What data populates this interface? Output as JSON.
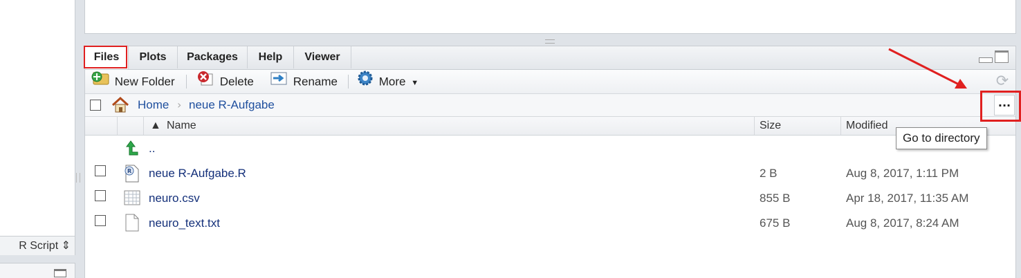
{
  "left_editor": {
    "filetype_label": "R Script ⇕"
  },
  "tabs": [
    {
      "label": "Files",
      "active": true
    },
    {
      "label": "Plots"
    },
    {
      "label": "Packages"
    },
    {
      "label": "Help"
    },
    {
      "label": "Viewer"
    }
  ],
  "toolbar": {
    "new_folder": "New Folder",
    "delete": "Delete",
    "rename": "Rename",
    "more": "More"
  },
  "breadcrumb": {
    "home": "Home",
    "current": "neue R-Aufgabe"
  },
  "goto_button": "...",
  "tooltip": "Go to directory",
  "columns": {
    "name": "Name",
    "size": "Size",
    "modified": "Modified"
  },
  "parent_dir": "..",
  "files": [
    {
      "name": "neue R-Aufgabe.R",
      "size": "2 B",
      "modified": "Aug 8, 2017, 1:11 PM",
      "icon": "r-script-icon"
    },
    {
      "name": "neuro.csv",
      "size": "855 B",
      "modified": "Apr 18, 2017, 11:35 AM",
      "icon": "csv-table-icon"
    },
    {
      "name": "neuro_text.txt",
      "size": "675 B",
      "modified": "Aug 8, 2017, 8:24 AM",
      "icon": "text-file-icon"
    }
  ],
  "colors": {
    "annotation_red": "#e02020",
    "link_blue": "#14307a"
  }
}
